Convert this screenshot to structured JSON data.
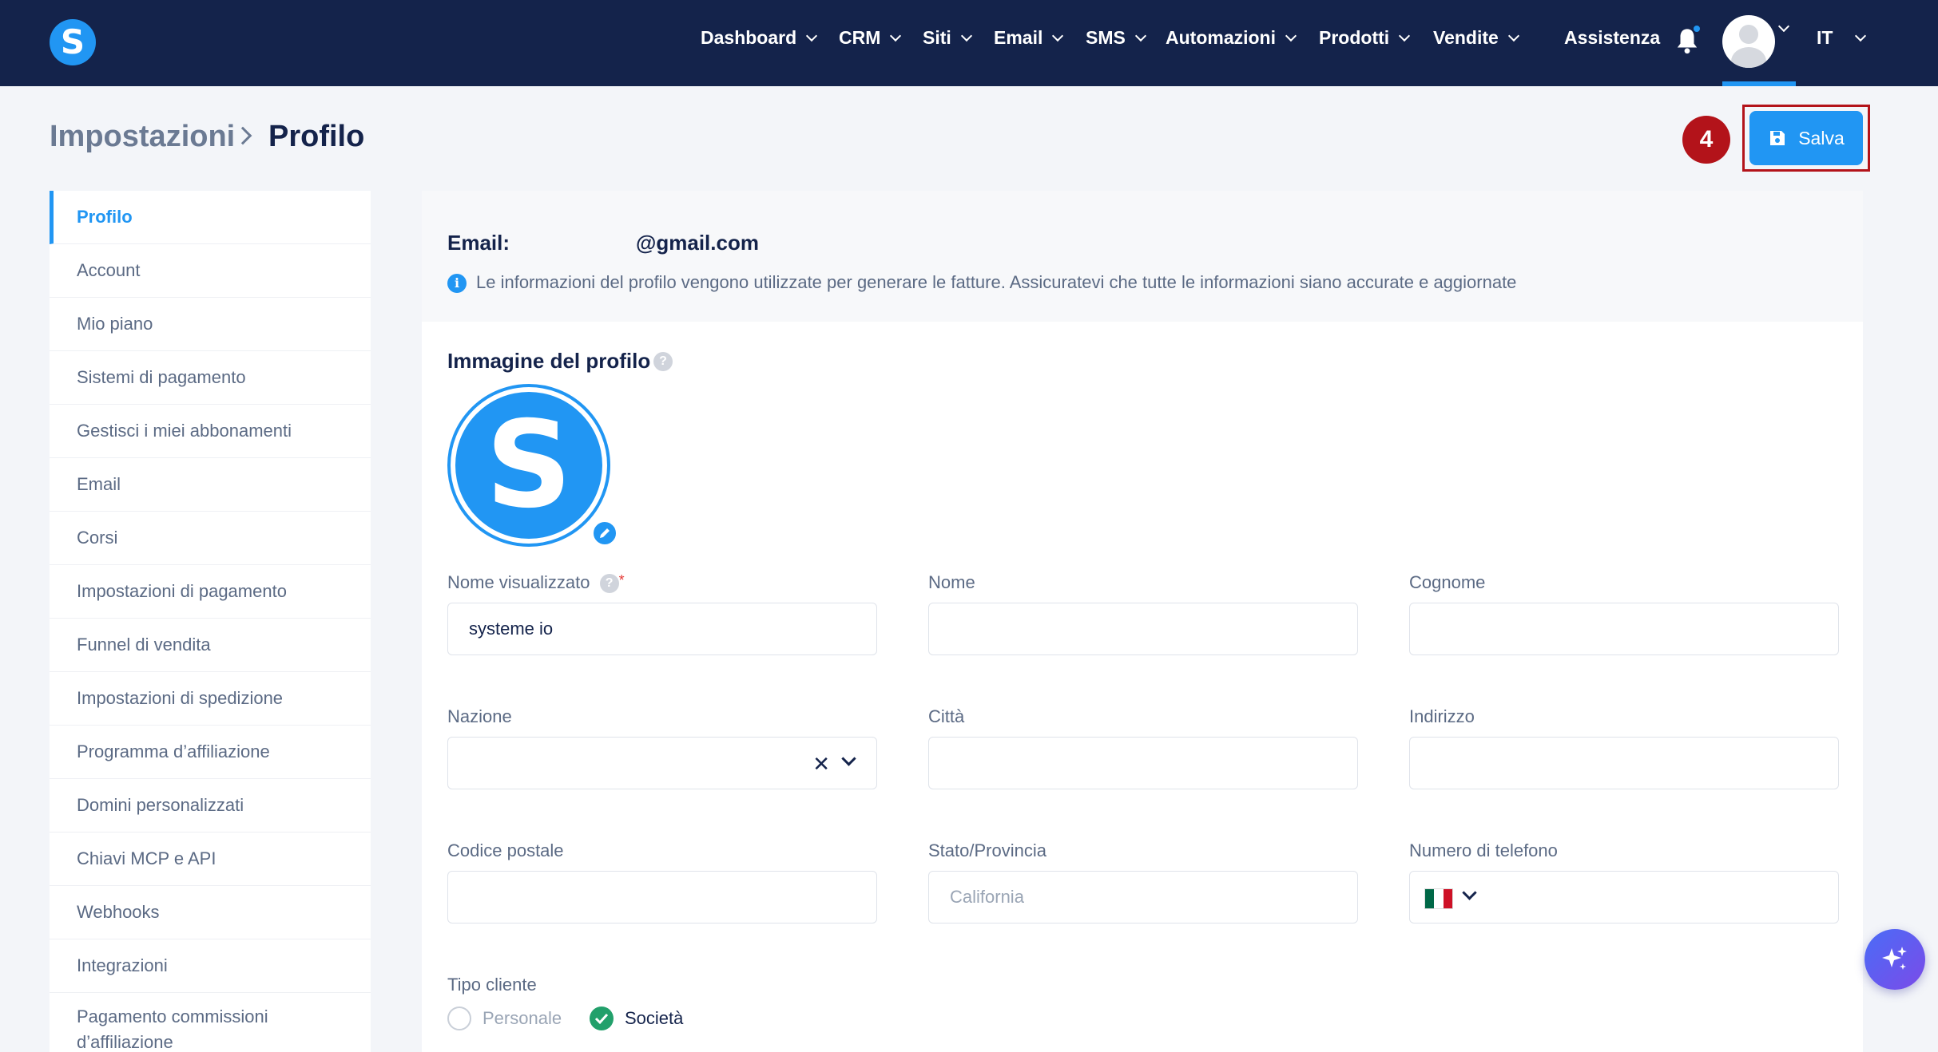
{
  "app": {
    "logo_letter": "S"
  },
  "nav": {
    "items": [
      {
        "label": "Dashboard"
      },
      {
        "label": "CRM"
      },
      {
        "label": "Siti"
      },
      {
        "label": "Email"
      },
      {
        "label": "SMS"
      },
      {
        "label": "Automazioni"
      },
      {
        "label": "Prodotti"
      },
      {
        "label": "Vendite"
      }
    ],
    "help_label": "Assistenza",
    "language": "IT"
  },
  "breadcrumb": {
    "parent": "Impostazioni",
    "current": "Profilo"
  },
  "step_badge": "4",
  "toolbar": {
    "save_label": "Salva"
  },
  "sidebar": {
    "items": [
      {
        "label": "Profilo"
      },
      {
        "label": "Account"
      },
      {
        "label": "Mio piano"
      },
      {
        "label": "Sistemi di pagamento"
      },
      {
        "label": "Gestisci i miei abbonamenti"
      },
      {
        "label": "Email"
      },
      {
        "label": "Corsi"
      },
      {
        "label": "Impostazioni di pagamento"
      },
      {
        "label": "Funnel di vendita"
      },
      {
        "label": "Impostazioni di spedizione"
      },
      {
        "label": "Programma d’affiliazione"
      },
      {
        "label": "Domini personalizzati"
      },
      {
        "label": "Chiavi MCP e API"
      },
      {
        "label": "Webhooks"
      },
      {
        "label": "Integrazioni"
      },
      {
        "label": "Pagamento commissioni d’affiliazione"
      }
    ]
  },
  "profile": {
    "email_label": "Email:",
    "email_value": "@gmail.com",
    "info_text": "Le informazioni del profilo vengono utilizzate per generare le fatture. Assicuratevi che tutte le informazioni siano accurate e aggiornate",
    "image_section_title": "Immagine del profilo",
    "image_letter": "S",
    "help_glyph": "?",
    "required_mark": "*",
    "fields": {
      "display_name": {
        "label": "Nome visualizzato",
        "value": "systeme io"
      },
      "first_name": {
        "label": "Nome",
        "value": ""
      },
      "last_name": {
        "label": "Cognome",
        "value": ""
      },
      "country": {
        "label": "Nazione",
        "value": "",
        "clear_glyph": "✕"
      },
      "city": {
        "label": "Città",
        "value": ""
      },
      "address": {
        "label": "Indirizzo",
        "value": ""
      },
      "postal_code": {
        "label": "Codice postale",
        "value": ""
      },
      "state": {
        "label": "Stato/Provincia",
        "placeholder": "California"
      },
      "phone": {
        "label": "Numero di telefono",
        "value": ""
      }
    },
    "customer_type": {
      "label": "Tipo cliente",
      "options": [
        {
          "label": "Personale",
          "selected": false
        },
        {
          "label": "Società",
          "selected": true
        }
      ]
    }
  },
  "colors": {
    "nav_bg": "#14234b",
    "accent": "#2196f3",
    "highlight_red": "#b3131a",
    "success_green": "#22a06b"
  }
}
